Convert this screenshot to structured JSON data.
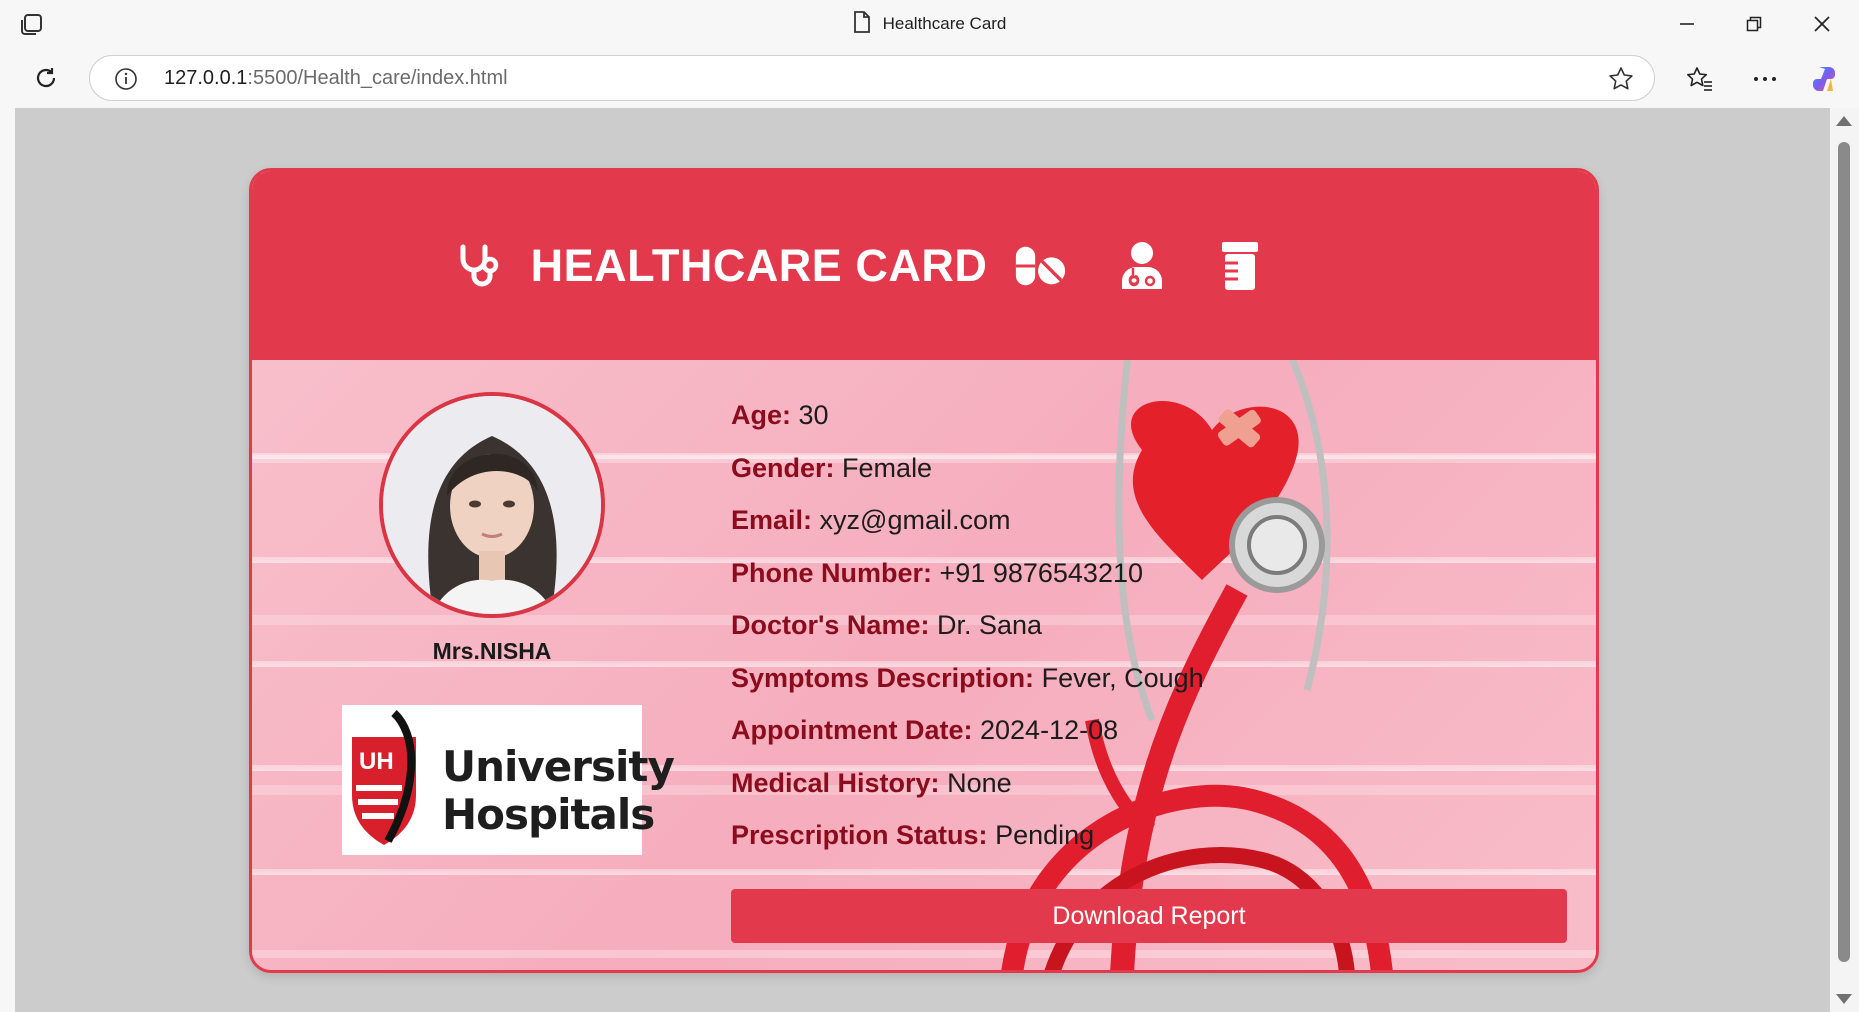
{
  "browser": {
    "tab_title": "Healthcare Card",
    "url_host": "127.0.0.1",
    "url_rest": ":5500/Health_care/index.html"
  },
  "card": {
    "title": "HEALTHCARE CARD",
    "patient_name": "Mrs.NISHA",
    "hospital_logo": "University Hospitals",
    "hospital_logo_line1": "University",
    "hospital_logo_line2": "Hospitals",
    "hospital_logo_mark": "UH",
    "fields": [
      {
        "label": "Age:",
        "value": "30"
      },
      {
        "label": "Gender:",
        "value": "Female"
      },
      {
        "label": "Email:",
        "value": "xyz@gmail.com"
      },
      {
        "label": "Phone Number:",
        "value": "+91 9876543210"
      },
      {
        "label": "Doctor's Name:",
        "value": "Dr. Sana"
      },
      {
        "label": "Symptoms Description:",
        "value": "Fever, Cough"
      },
      {
        "label": "Appointment Date:",
        "value": "2024-12-08"
      },
      {
        "label": "Medical History:",
        "value": "None"
      },
      {
        "label": "Prescription Status:",
        "value": "Pending"
      }
    ],
    "download_label": "Download Report"
  },
  "icons": {
    "header": [
      "stethoscope-icon",
      "pills-icon",
      "user-doctor-icon",
      "prescription-bottle-icon"
    ]
  },
  "colors": {
    "accent": "#e23a4c",
    "label": "#8b0c1c",
    "card_bg": "#f6b6c3"
  }
}
